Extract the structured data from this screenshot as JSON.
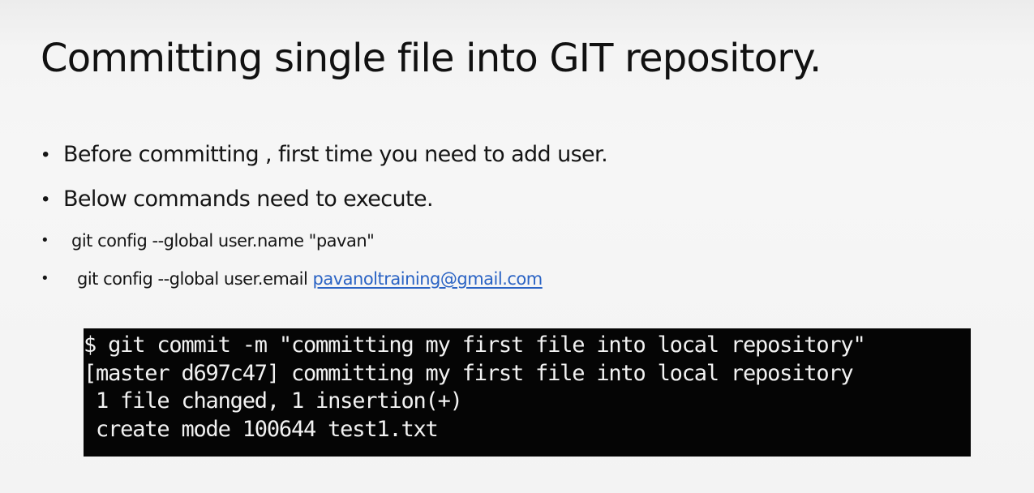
{
  "slide": {
    "title": "Committing single file into GIT repository."
  },
  "bullets": {
    "bullet_glyph": "•",
    "items": [
      {
        "text": "Before committing , first time you need to add user."
      },
      {
        "text": "Below commands need to execute."
      },
      {
        "text": "git config --global user.name \"pavan\""
      },
      {
        "text": "git config --global user.email ",
        "link": "pavanoltraining@gmail.com"
      }
    ]
  },
  "terminal": {
    "lines": [
      "$ git commit -m \"committing my first file into local repository\"",
      "[master d697c47] committing my first file into local repository",
      " 1 file changed, 1 insertion(+)",
      " create mode 100644 test1.txt"
    ],
    "background_color": "#050505",
    "text_color": "#f2f2f2"
  },
  "colors": {
    "link": "#2a63c4",
    "text": "#111111"
  }
}
